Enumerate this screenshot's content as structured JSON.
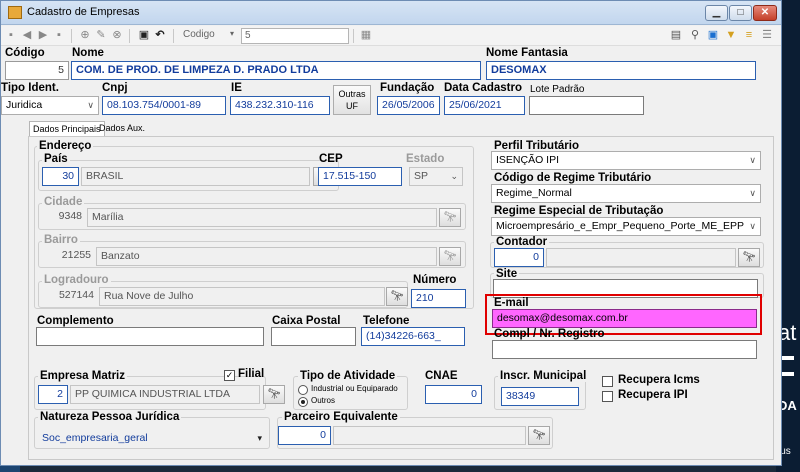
{
  "window": {
    "title": "Cadastro de Empresas"
  },
  "toolbar": {
    "codigo_label": "Codigo",
    "codigo_value": "5"
  },
  "header": {
    "codigo_label": "Código",
    "codigo_value": "5",
    "nome_label": "Nome",
    "nome_value": "COM. DE PROD. DE LIMPEZA D. PRADO LTDA",
    "fantasia_label": "Nome Fantasia",
    "fantasia_value": "DESOMAX",
    "tipo_ident_label": "Tipo Ident.",
    "tipo_ident_value": "Juridica",
    "cnpj_label": "Cnpj",
    "cnpj_value": "08.103.754/0001-89",
    "ie_label": "IE",
    "ie_value": "438.232.310-116",
    "outras_uf_line1": "Outras",
    "outras_uf_line2": "UF",
    "fundacao_label": "Fundação",
    "fundacao_value": "26/05/2006",
    "data_cadastro_label": "Data Cadastro",
    "data_cadastro_value": "25/06/2021",
    "lote_padrao_label": "Lote Padrão",
    "lote_padrao_value": ""
  },
  "tabs": [
    {
      "label": "Dados Principais"
    },
    {
      "label": "Dados Aux."
    }
  ],
  "endereco": {
    "title": "Endereço",
    "pais_label": "País",
    "pais_code": "30",
    "pais_name": "BRASIL",
    "cep_label": "CEP",
    "cep_value": "17.515-150",
    "estado_label": "Estado",
    "estado_value": "SP",
    "cidade_label": "Cidade",
    "cidade_code": "9348",
    "cidade_name": "Marília",
    "bairro_label": "Bairro",
    "bairro_code": "21255",
    "bairro_name": "Banzato",
    "logradouro_label": "Logradouro",
    "logradouro_code": "527144",
    "logradouro_name": "Rua Nove de Julho",
    "numero_label": "Número",
    "numero_value": "210"
  },
  "contato": {
    "complemento_label": "Complemento",
    "complemento_value": "",
    "caixa_postal_label": "Caixa Postal",
    "caixa_postal_value": "",
    "telefone_label": "Telefone",
    "telefone_value": "(14)34226-663_"
  },
  "fiscal": {
    "perfil_label": "Perfil Tributário",
    "perfil_value": "ISENÇÃO IPI",
    "regime_label": "Código de Regime Tributário",
    "regime_value": "Regime_Normal",
    "regime_especial_label": "Regime Especial de Tributação",
    "regime_especial_value": "Microempresário_e_Empr_Pequeno_Porte_ME_EPP",
    "contador_label": "Contador",
    "contador_code": "0",
    "contador_name": "",
    "site_label": "Site",
    "site_value": "",
    "email_label": "E-mail",
    "email_value": "desomax@desomax.com.br",
    "compl_registro_label": "Compl / Nr. Registro",
    "compl_registro_value": ""
  },
  "bottom": {
    "empresa_matriz_label": "Empresa Matriz",
    "filial_label": "Filial",
    "filial_checked": true,
    "matriz_code": "2",
    "matriz_name": "PP QUIMICA INDUSTRIAL LTDA",
    "tipo_atividade_label": "Tipo de Atividade",
    "atividade_opt1": "Industrial ou Equiparado",
    "atividade_opt2": "Outros",
    "atividade_selected": "Outros",
    "cnae_label": "CNAE",
    "cnae_value": "0",
    "inscr_municipal_label": "Inscr. Municipal",
    "inscr_municipal_value": "38349",
    "recupera_icms_label": "Recupera Icms",
    "recupera_ipi_label": "Recupera IPI",
    "natureza_label": "Natureza Pessoa Jurídica",
    "natureza_value": "Soc_empresaria_geral",
    "parceiro_label": "Parceiro Equivalente",
    "parceiro_code": "0",
    "parceiro_name": ""
  },
  "background": {
    "text_1": "at",
    "text_2": "DA",
    "text_3": "lus"
  },
  "colors": {
    "email_highlight": "#ff66ff",
    "callout_border": "#e00000",
    "accent_blue": "#123c9c"
  }
}
